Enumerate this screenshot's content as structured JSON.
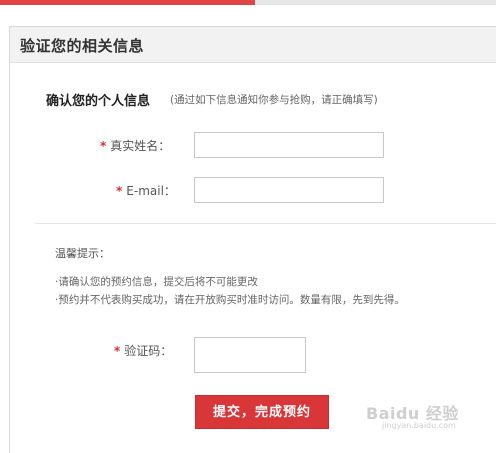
{
  "colors": {
    "accent": "#e04444",
    "button_bg": "#d9363a",
    "required_star": "#d43030"
  },
  "panel": {
    "title": "验证您的相关信息"
  },
  "personal_info": {
    "heading": "确认您的个人信息",
    "note": "(通过如下信息通知你参与抢购，请正确填写)"
  },
  "form": {
    "required_mark": "*",
    "name_label": "真实姓名：",
    "name_value": "",
    "email_label": "E-mail：",
    "email_value": "",
    "captcha_label": "验证码：",
    "captcha_value": ""
  },
  "tips": {
    "title": "温馨提示：",
    "lines": [
      "·请确认您的预约信息，提交后将不可能更改",
      "·预约并不代表购买成功，请在开放购买时准时访问。数量有限，先到先得。"
    ]
  },
  "submit": {
    "label": "提交，完成预约"
  },
  "watermark": {
    "brand": "Baidu 经验",
    "url": "jingyan.baidu.com",
    "icon": "baidu-paw-icon"
  }
}
